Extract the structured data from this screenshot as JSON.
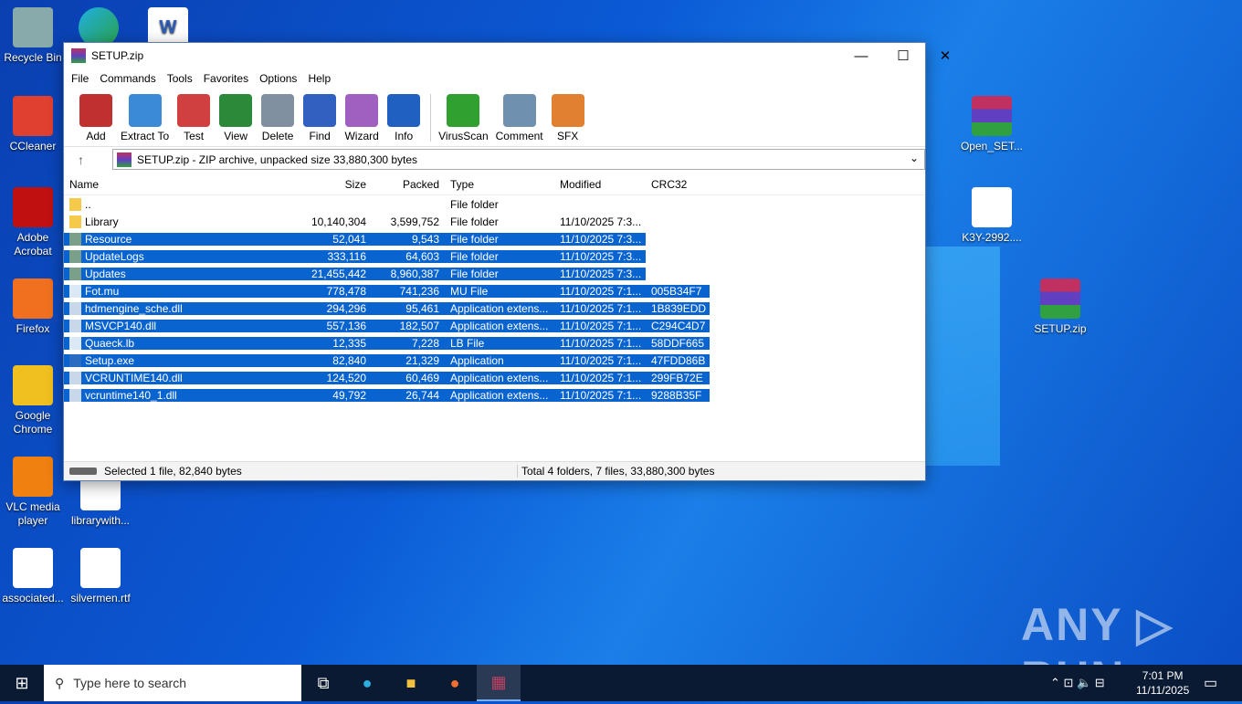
{
  "desktop": {
    "icons_left": [
      "Recycle Bin",
      "CCleaner",
      "Adobe Acrobat",
      "Firefox",
      "Google Chrome",
      "VLC media player",
      "associated...",
      "librarywith...",
      "silvermen.rtf"
    ],
    "icons_right": [
      "Open_SET...",
      "K3Y-2992....",
      "SETUP.zip"
    ]
  },
  "window": {
    "title": "SETUP.zip",
    "minimize": "—",
    "maximize": "☐",
    "close": "✕"
  },
  "menu": [
    "File",
    "Commands",
    "Tools",
    "Favorites",
    "Options",
    "Help"
  ],
  "toolbar": [
    {
      "label": "Add",
      "color": "#c03030"
    },
    {
      "label": "Extract To",
      "color": "#3a8ad8"
    },
    {
      "label": "Test",
      "color": "#d04040"
    },
    {
      "label": "View",
      "color": "#2a8a3a"
    },
    {
      "label": "Delete",
      "color": "#8090a0"
    },
    {
      "label": "Find",
      "color": "#3060c0"
    },
    {
      "label": "Wizard",
      "color": "#a060c0"
    },
    {
      "label": "Info",
      "color": "#2060c0"
    },
    {
      "label": "VirusScan",
      "color": "#30a030"
    },
    {
      "label": "Comment",
      "color": "#7090b0"
    },
    {
      "label": "SFX",
      "color": "#e08030"
    }
  ],
  "address": {
    "up": "↑",
    "text": "SETUP.zip - ZIP archive, unpacked size 33,880,300 bytes",
    "dropdown": "⌄"
  },
  "columns": [
    "Name",
    "Size",
    "Packed",
    "Type",
    "Modified",
    "CRC32"
  ],
  "files": [
    {
      "name": "..",
      "size": "",
      "packed": "",
      "type": "File folder",
      "modified": "",
      "crc": "",
      "kind": "folder",
      "sel": false
    },
    {
      "name": "Library",
      "size": "10,140,304",
      "packed": "3,599,752",
      "type": "File folder",
      "modified": "11/10/2025 7:3...",
      "crc": "",
      "kind": "folder",
      "sel": false
    },
    {
      "name": "Resource",
      "size": "52,041",
      "packed": "9,543",
      "type": "File folder",
      "modified": "11/10/2025 7:3...",
      "crc": "",
      "kind": "folder",
      "sel": true
    },
    {
      "name": "UpdateLogs",
      "size": "333,116",
      "packed": "64,603",
      "type": "File folder",
      "modified": "11/10/2025 7:3...",
      "crc": "",
      "kind": "folder",
      "sel": true
    },
    {
      "name": "Updates",
      "size": "21,455,442",
      "packed": "8,960,387",
      "type": "File folder",
      "modified": "11/10/2025 7:3...",
      "crc": "",
      "kind": "folder",
      "sel": true
    },
    {
      "name": "Fot.mu",
      "size": "778,478",
      "packed": "741,236",
      "type": "MU File",
      "modified": "11/10/2025 7:1...",
      "crc": "005B34F7",
      "kind": "file",
      "sel": true
    },
    {
      "name": "hdmengine_sche.dll",
      "size": "294,296",
      "packed": "95,461",
      "type": "Application extens...",
      "modified": "11/10/2025 7:1...",
      "crc": "1B839EDD",
      "kind": "dll",
      "sel": true
    },
    {
      "name": "MSVCP140.dll",
      "size": "557,136",
      "packed": "182,507",
      "type": "Application extens...",
      "modified": "11/10/2025 7:1...",
      "crc": "C294C4D7",
      "kind": "dll",
      "sel": true
    },
    {
      "name": "Quaeck.lb",
      "size": "12,335",
      "packed": "7,228",
      "type": "LB File",
      "modified": "11/10/2025 7:1...",
      "crc": "58DDF665",
      "kind": "file",
      "sel": true
    },
    {
      "name": "Setup.exe",
      "size": "82,840",
      "packed": "21,329",
      "type": "Application",
      "modified": "11/10/2025 7:1...",
      "crc": "47FDD86B",
      "kind": "exe",
      "sel": true
    },
    {
      "name": "VCRUNTIME140.dll",
      "size": "124,520",
      "packed": "60,469",
      "type": "Application extens...",
      "modified": "11/10/2025 7:1...",
      "crc": "299FB72E",
      "kind": "dll",
      "sel": true
    },
    {
      "name": "vcruntime140_1.dll",
      "size": "49,792",
      "packed": "26,744",
      "type": "Application extens...",
      "modified": "11/10/2025 7:1...",
      "crc": "9288B35F",
      "kind": "dll",
      "sel": true
    }
  ],
  "status": {
    "left": "Selected 1 file, 82,840 bytes",
    "right": "Total 4 folders, 7 files, 33,880,300 bytes"
  },
  "taskbar": {
    "search_placeholder": "Type here to search",
    "time": "7:01 PM",
    "date": "11/11/2025"
  },
  "watermark": "ANY ▷ RUN"
}
